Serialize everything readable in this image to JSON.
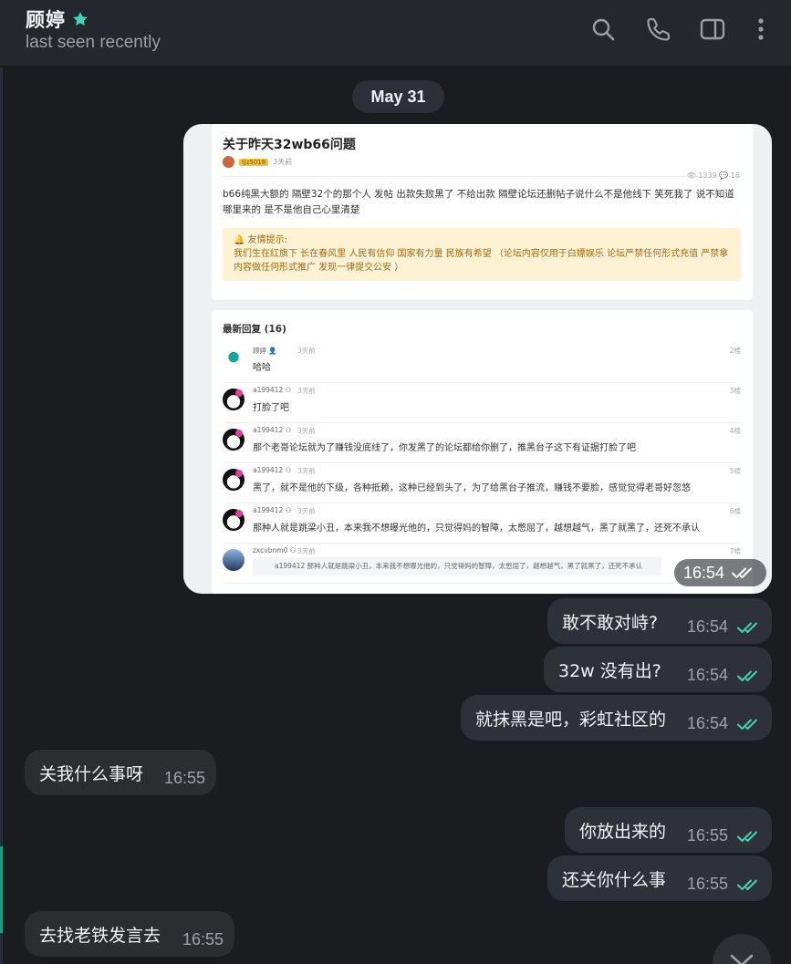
{
  "header": {
    "contact_name": "顾婷",
    "status": "last seen recently"
  },
  "date_separator": "May 31",
  "image_message": {
    "time": "16:54",
    "post": {
      "title": "关于昨天32wb66问题",
      "author_tag": "tjz5018",
      "posted": "3天前",
      "stats": "👁 1339   💬 16",
      "body": "b66纯黑大额的 隔壁32个的那个人 发帖 出款失败黑了 不给出款 隔壁论坛还删帖子说什么不是他线下 笑死我了 说不知道哪里来的 是不是他自己心里清楚",
      "notice_title": "🔔 友情提示:",
      "notice_body": "我们生在红旗下 长在春风里 人民有信仰 国家有力量 民族有希望 （论坛内容仅用于白嫖娱乐 论坛严禁任何形式充值 严禁拿内容做任何形式推广 发现一律提交公安 ）"
    },
    "replies_header": "最新回复 (16)",
    "replies": [
      {
        "name": "顾婷 👤",
        "time": "3天前",
        "floor": "2楼",
        "text": "哈哈"
      },
      {
        "name": "a199412 ⚇",
        "time": "3天前",
        "floor": "3楼",
        "text": "打脸了吧"
      },
      {
        "name": "a199412 ⚇",
        "time": "3天前",
        "floor": "4楼",
        "text": "那个老哥论坛就为了赚钱没底线了，你发黑了的论坛都给你删了，推黑台子这下有证据打脸了吧"
      },
      {
        "name": "a199412 ⚇",
        "time": "3天前",
        "floor": "5楼",
        "text": "黑了，就不是他的下级，各种抵赖，这种已经到头了，为了给黑台子推流，赚钱不要脸，感觉觉得老哥好忽悠"
      },
      {
        "name": "a199412 ⚇",
        "time": "3天前",
        "floor": "6楼",
        "text": "那种人就是跳梁小丑，本来我不想曝光他的，只觉得妈的智障，太憋屈了，越想越气，黑了就黑了，还死不承认"
      },
      {
        "name": "zxcvbnm0 ⚇",
        "time": "3天前",
        "floor": "7楼",
        "quote": "a199412   那种人就是跳梁小丑，本来我不想曝光他的，只觉得妈的智障，太憋屈了，越想越气，黑了就黑了，还死不承认"
      }
    ]
  },
  "messages": [
    {
      "dir": "out",
      "text": "敢不敢对峙?",
      "time": "16:54"
    },
    {
      "dir": "out",
      "text": "32w 没有出?",
      "time": "16:54"
    },
    {
      "dir": "out",
      "text": "就抹黑是吧，彩虹社区的",
      "time": "16:54"
    },
    {
      "dir": "in",
      "text": "关我什么事呀",
      "time": "16:55"
    },
    {
      "dir": "out",
      "text": "你放出来的",
      "time": "16:55"
    },
    {
      "dir": "out",
      "text": "还关你什么事",
      "time": "16:55"
    },
    {
      "dir": "in",
      "text": "去找老铁发言去",
      "time": "16:55"
    }
  ],
  "colors": {
    "accent": "#3ed6b5",
    "background": "#1b1c20",
    "header": "#24272c",
    "bubble_out": "#2e3137",
    "bubble_in": "#2b2d31"
  },
  "icons": [
    "star-icon",
    "search-icon",
    "phone-icon",
    "sidebar-toggle-icon",
    "more-vertical-icon",
    "double-check-icon",
    "chevron-down-icon"
  ]
}
